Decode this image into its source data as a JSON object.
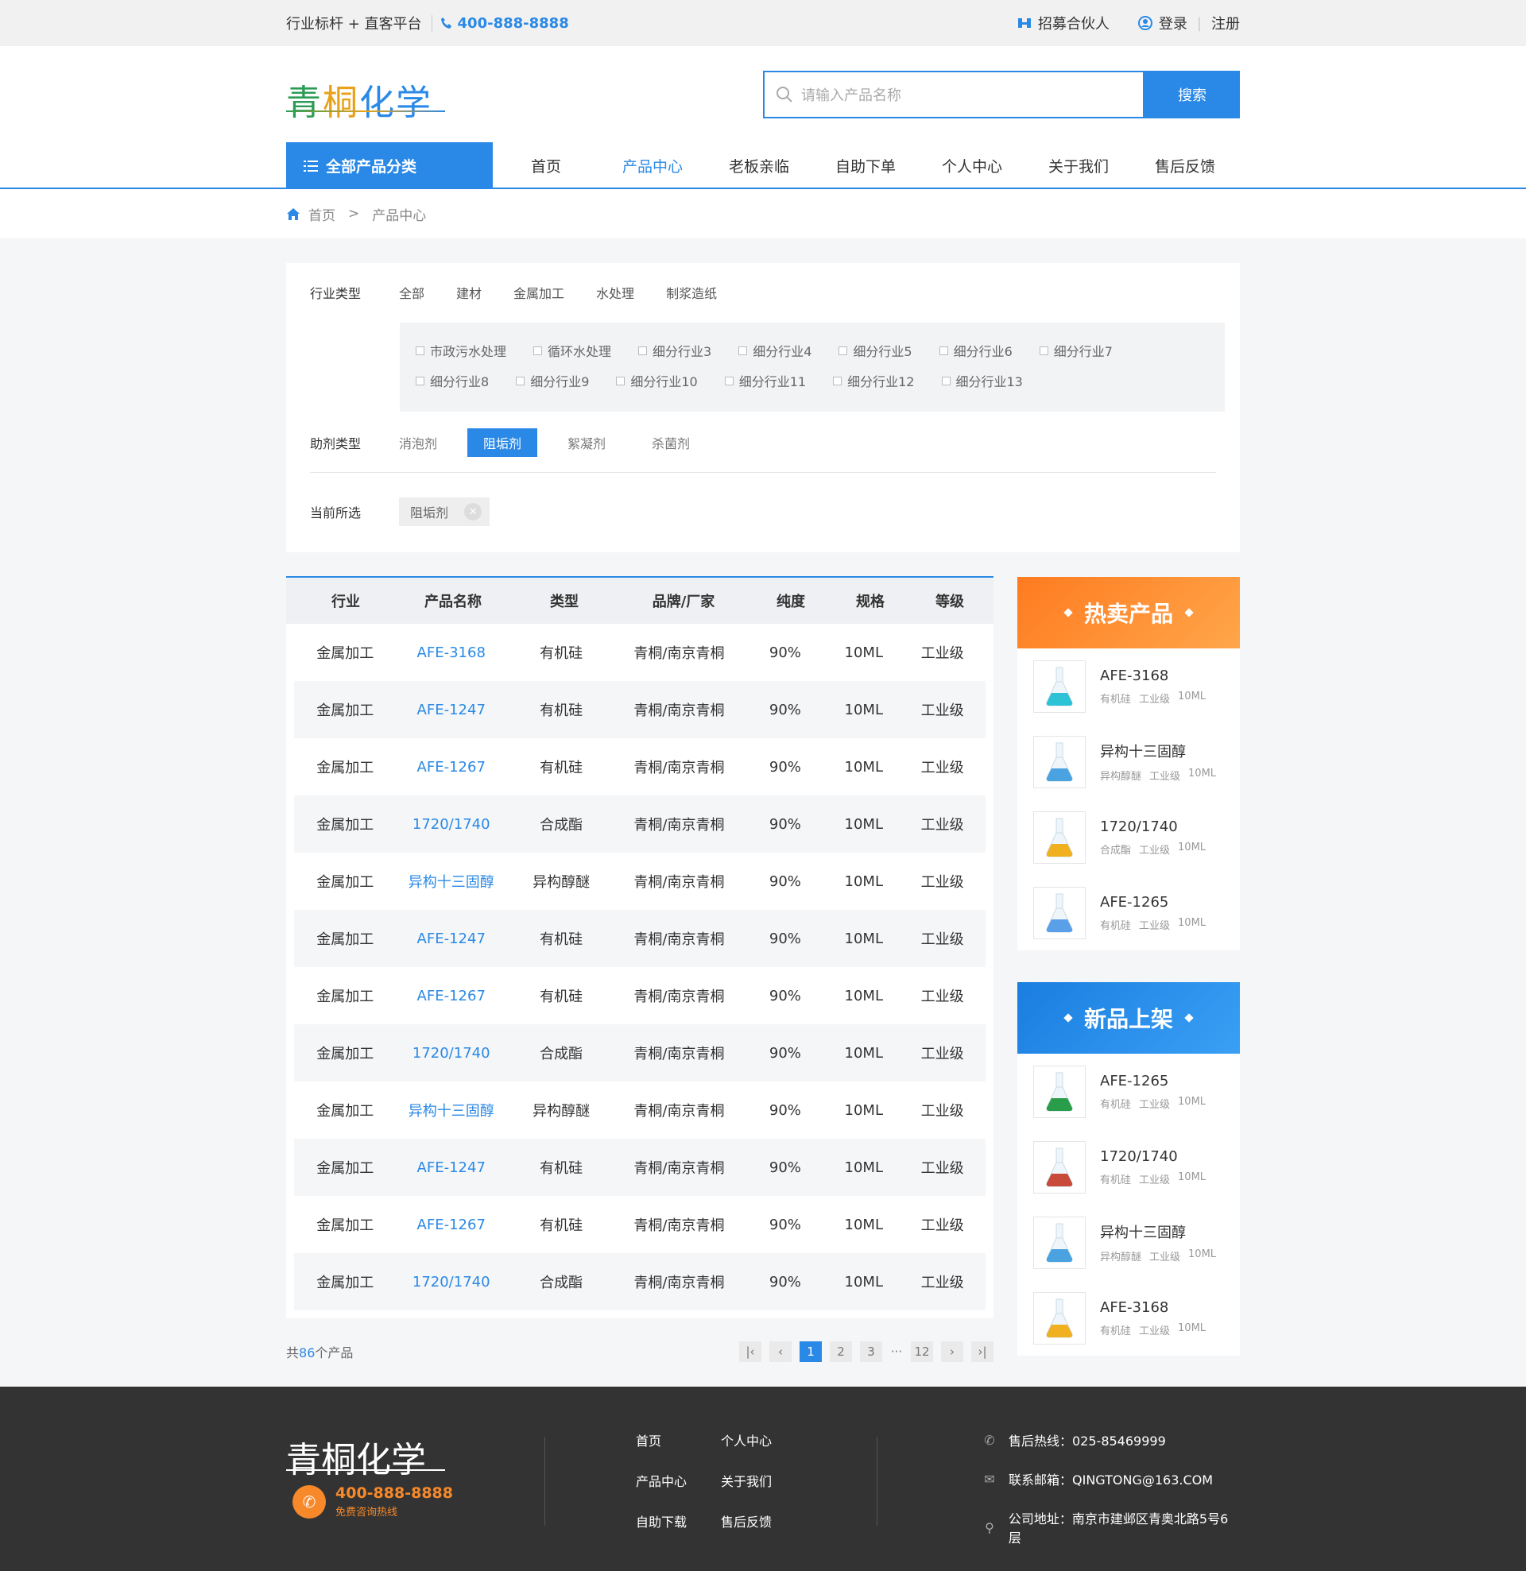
{
  "topbar": {
    "slogan": "行业标杆 + 直客平台",
    "phone": "400-888-8888",
    "recruit": "招募合伙人",
    "login": "登录",
    "register": "注册"
  },
  "header": {
    "logo_chars": [
      "青",
      "桐",
      "化",
      "学"
    ],
    "search_placeholder": "请输入产品名称",
    "search_button": "搜索",
    "category_button": "全部产品分类",
    "nav": [
      "首页",
      "产品中心",
      "老板亲临",
      "自助下单",
      "个人中心",
      "关于我们",
      "售后反馈"
    ],
    "nav_active_index": 1
  },
  "breadcrumb": {
    "home": "首页",
    "sep": ">",
    "current": "产品中心"
  },
  "filter": {
    "industry_label": "行业类型",
    "industries": [
      "全部",
      "建材",
      "金属加工",
      "水处理",
      "制浆造纸"
    ],
    "sub_row1": [
      "市政污水处理",
      "循环水处理",
      "细分行业3",
      "细分行业4",
      "细分行业5",
      "细分行业6",
      "细分行业7"
    ],
    "sub_row2": [
      "细分行业8",
      "细分行业9",
      "细分行业10",
      "细分行业11",
      "细分行业12",
      "细分行业13"
    ],
    "additive_label": "助剂类型",
    "additives": [
      "消泡剂",
      "阻垢剂",
      "絮凝剂",
      "杀菌剂"
    ],
    "additive_active_index": 1,
    "selected_label": "当前所选",
    "selected_chip": "阻垢剂"
  },
  "table": {
    "headers": [
      "行业",
      "产品名称",
      "类型",
      "品牌/厂家",
      "纯度",
      "规格",
      "等级"
    ],
    "rows": [
      [
        "金属加工",
        "AFE-3168",
        "有机硅",
        "青桐/南京青桐",
        "90%",
        "10ML",
        "工业级"
      ],
      [
        "金属加工",
        "AFE-1247",
        "有机硅",
        "青桐/南京青桐",
        "90%",
        "10ML",
        "工业级"
      ],
      [
        "金属加工",
        "AFE-1267",
        "有机硅",
        "青桐/南京青桐",
        "90%",
        "10ML",
        "工业级"
      ],
      [
        "金属加工",
        "1720/1740",
        "合成酯",
        "青桐/南京青桐",
        "90%",
        "10ML",
        "工业级"
      ],
      [
        "金属加工",
        "异构十三固醇",
        "异构醇醚",
        "青桐/南京青桐",
        "90%",
        "10ML",
        "工业级"
      ],
      [
        "金属加工",
        "AFE-1247",
        "有机硅",
        "青桐/南京青桐",
        "90%",
        "10ML",
        "工业级"
      ],
      [
        "金属加工",
        "AFE-1267",
        "有机硅",
        "青桐/南京青桐",
        "90%",
        "10ML",
        "工业级"
      ],
      [
        "金属加工",
        "1720/1740",
        "合成酯",
        "青桐/南京青桐",
        "90%",
        "10ML",
        "工业级"
      ],
      [
        "金属加工",
        "异构十三固醇",
        "异构醇醚",
        "青桐/南京青桐",
        "90%",
        "10ML",
        "工业级"
      ],
      [
        "金属加工",
        "AFE-1247",
        "有机硅",
        "青桐/南京青桐",
        "90%",
        "10ML",
        "工业级"
      ],
      [
        "金属加工",
        "AFE-1267",
        "有机硅",
        "青桐/南京青桐",
        "90%",
        "10ML",
        "工业级"
      ],
      [
        "金属加工",
        "1720/1740",
        "合成酯",
        "青桐/南京青桐",
        "90%",
        "10ML",
        "工业级"
      ]
    ],
    "total_prefix": "共",
    "total_count": "86",
    "total_suffix": "个产品",
    "pages": [
      "1",
      "2",
      "3",
      "···",
      "12"
    ],
    "current_page": "1"
  },
  "hot": {
    "title": "热卖产品",
    "items": [
      {
        "name": "AFE-3168",
        "type": "有机硅",
        "grade": "工业级",
        "spec": "10ML",
        "liquid": "#2ec2d6"
      },
      {
        "name": "异构十三固醇",
        "type": "异构醇醚",
        "grade": "工业级",
        "spec": "10ML",
        "liquid": "#4aa3e0"
      },
      {
        "name": "1720/1740",
        "type": "合成酯",
        "grade": "工业级",
        "spec": "10ML",
        "liquid": "#f0b020"
      },
      {
        "name": "AFE-1265",
        "type": "有机硅",
        "grade": "工业级",
        "spec": "10ML",
        "liquid": "#5aa0e8"
      }
    ]
  },
  "new": {
    "title": "新品上架",
    "items": [
      {
        "name": "AFE-1265",
        "type": "有机硅",
        "grade": "工业级",
        "spec": "10ML",
        "liquid": "#2a9d4a"
      },
      {
        "name": "1720/1740",
        "type": "有机硅",
        "grade": "工业级",
        "spec": "10ML",
        "liquid": "#c84a3a"
      },
      {
        "name": "异构十三固醇",
        "type": "异构醇醚",
        "grade": "工业级",
        "spec": "10ML",
        "liquid": "#4aa3e0"
      },
      {
        "name": "AFE-3168",
        "type": "有机硅",
        "grade": "工业级",
        "spec": "10ML",
        "liquid": "#f0b020"
      }
    ]
  },
  "footer": {
    "logo": "青桐化学",
    "phone": "400-888-8888",
    "phone_sub": "免费咨询热线",
    "links": [
      "首页",
      "个人中心",
      "产品中心",
      "关于我们",
      "自助下载",
      "售后反馈"
    ],
    "hotline": "售后热线：025-85469999",
    "email": "联系邮箱：QINGTONG@163.COM",
    "address": "公司地址：南京市建邺区青奥北路5号6层"
  },
  "colors": {
    "primary": "#2a89e6",
    "hot": "#ff8a2a",
    "footer_bg": "#333333"
  }
}
